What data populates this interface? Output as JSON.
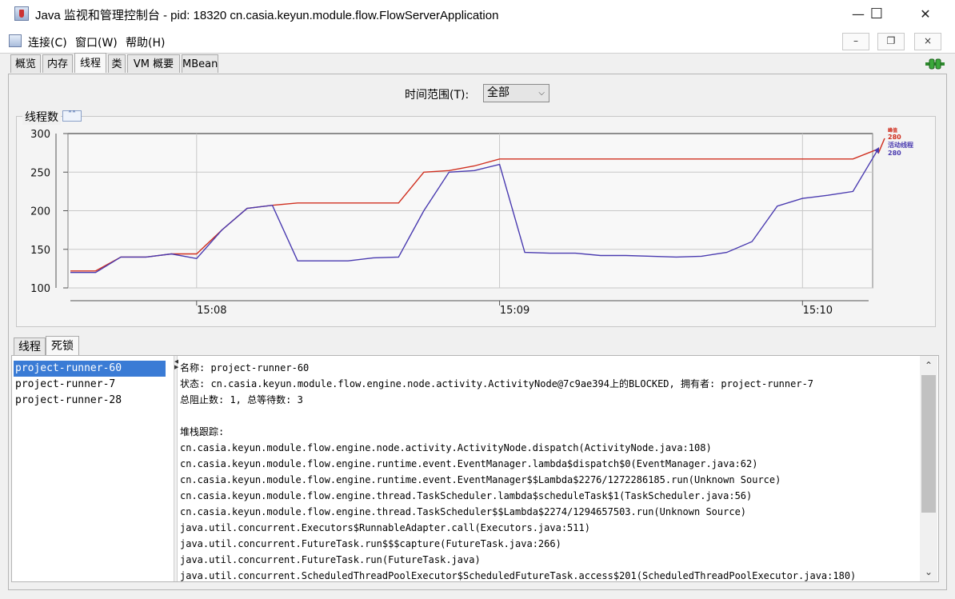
{
  "window": {
    "title": "Java 监视和管理控制台 - pid: 18320 cn.casia.keyun.module.flow.FlowServerApplication",
    "minimize": "—",
    "maximize": "☐",
    "close": "✕"
  },
  "menu": {
    "items": [
      "连接(C)",
      "窗口(W)",
      "帮助(H)"
    ],
    "mdi_min": "–",
    "mdi_restore": "❐",
    "mdi_close": "×"
  },
  "tabs": [
    "概览",
    "内存",
    "线程",
    "类",
    "VM 概要",
    "MBean"
  ],
  "active_tab": "线程",
  "time_range": {
    "label": "时间范围(T):",
    "selected": "全部"
  },
  "chart_panel": {
    "title": "线程数",
    "collapse_icon": "chevron-up-icon"
  },
  "chart_data": {
    "type": "line",
    "x": [
      "15:07:35",
      "15:07:40",
      "15:07:45",
      "15:07:50",
      "15:07:55",
      "15:08:00",
      "15:08:05",
      "15:08:10",
      "15:08:15",
      "15:08:20",
      "15:08:25",
      "15:08:30",
      "15:08:35",
      "15:08:40",
      "15:08:45",
      "15:08:50",
      "15:08:55",
      "15:09:00",
      "15:09:05",
      "15:09:10",
      "15:09:15",
      "15:09:20",
      "15:09:25",
      "15:09:30",
      "15:09:35",
      "15:09:40",
      "15:09:45",
      "15:09:50",
      "15:09:55",
      "15:10:00",
      "15:10:05",
      "15:10:10",
      "15:10:15"
    ],
    "series": [
      {
        "name": "峰值",
        "color": "#d03020",
        "values": [
          122,
          122,
          140,
          140,
          144,
          144,
          175,
          203,
          207,
          210,
          210,
          210,
          210,
          210,
          250,
          252,
          258,
          267,
          267,
          267,
          267,
          267,
          267,
          267,
          267,
          267,
          267,
          267,
          267,
          267,
          267,
          267,
          280
        ]
      },
      {
        "name": "活动线程",
        "color": "#4a3bb0",
        "values": [
          120,
          120,
          140,
          140,
          144,
          138,
          175,
          203,
          207,
          135,
          135,
          135,
          139,
          140,
          200,
          250,
          252,
          260,
          146,
          145,
          145,
          142,
          142,
          141,
          140,
          141,
          146,
          160,
          206,
          216,
          220,
          225,
          280
        ]
      }
    ],
    "legend": {
      "peak_value": "280",
      "peak_label": "峰值",
      "live_label": "活动线程",
      "live_value": "280"
    },
    "yticks": [
      "300",
      "250",
      "200",
      "150",
      "100"
    ],
    "xticks": [
      "15:08",
      "15:09",
      "15:10"
    ],
    "ylim": [
      100,
      300
    ],
    "grid": true
  },
  "subtabs": [
    "线程",
    "死锁"
  ],
  "active_subtab": "死锁",
  "threads": [
    "project-runner-60",
    "project-runner-7",
    "project-runner-28"
  ],
  "selected_thread": "project-runner-60",
  "details": {
    "name": "名称: project-runner-60",
    "state": "状态: cn.casia.keyun.module.flow.engine.node.activity.ActivityNode@7c9ae394上的BLOCKED, 拥有者: project-runner-7",
    "counts": "总阻止数: 1, 总等待数: 3",
    "stack_title": "堆栈跟踪:",
    "stack": [
      "cn.casia.keyun.module.flow.engine.node.activity.ActivityNode.dispatch(ActivityNode.java:108)",
      "cn.casia.keyun.module.flow.engine.runtime.event.EventManager.lambda$dispatch$0(EventManager.java:62)",
      "cn.casia.keyun.module.flow.engine.runtime.event.EventManager$$Lambda$2276/1272286185.run(Unknown Source)",
      "cn.casia.keyun.module.flow.engine.thread.TaskScheduler.lambda$scheduleTask$1(TaskScheduler.java:56)",
      "cn.casia.keyun.module.flow.engine.thread.TaskScheduler$$Lambda$2274/1294657503.run(Unknown Source)",
      "java.util.concurrent.Executors$RunnableAdapter.call(Executors.java:511)",
      "java.util.concurrent.FutureTask.run$$$capture(FutureTask.java:266)",
      "java.util.concurrent.FutureTask.run(FutureTask.java)",
      "java.util.concurrent.ScheduledThreadPoolExecutor$ScheduledFutureTask.access$201(ScheduledThreadPoolExecutor.java:180)"
    ]
  }
}
